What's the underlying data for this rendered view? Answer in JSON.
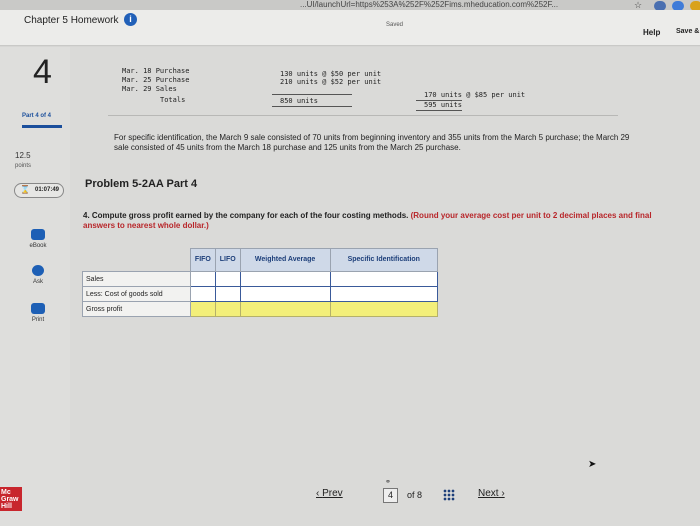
{
  "browser": {
    "url": "...UI/launchUrl=https%253A%252F%252Fims.mheducation.com%252F..."
  },
  "header": {
    "title": "Chapter 5 Homework",
    "info_glyph": "i",
    "saved": "Saved",
    "help": "Help",
    "save_exit": "Save &"
  },
  "sidebar": {
    "question_number": "4",
    "part": "Part 4 of 4",
    "points_value": "12.5",
    "points_label": "points",
    "timer": "01:07:49",
    "tools": [
      {
        "label": "eBook",
        "icon": "book-icon"
      },
      {
        "label": "Ask",
        "icon": "chat-icon"
      },
      {
        "label": "Print",
        "icon": "print-icon"
      }
    ],
    "logo": "Mc Graw Hill"
  },
  "transactions": {
    "rows": [
      {
        "label": "Mar. 18 Purchase",
        "units": "130 units @ $50 per unit"
      },
      {
        "label": "Mar. 25 Purchase",
        "units": "210 units @ $52 per unit"
      },
      {
        "label": "Mar. 29 Sales",
        "units": "",
        "sales": "170 units @ $85 per unit"
      },
      {
        "label": "Totals",
        "units": "850 units",
        "sales": "595 units"
      }
    ]
  },
  "problem": {
    "specific_id_note": "For specific identification, the March 9 sale consisted of 70 units from beginning inventory and 355 units from the March 5 purchase; the March 29 sale consisted of 45 units from the March 18 purchase and 125 units from the March 25 purchase.",
    "title": "Problem 5-2AA Part 4",
    "instruction": "4. Compute gross profit earned by the company for each of the four costing methods.",
    "instruction_emphasis": "(Round your average cost per unit to 2 decimal places and final answers to nearest whole dollar.)"
  },
  "table": {
    "headers": [
      "FIFO",
      "LIFO",
      "Weighted Average",
      "Specific Identification"
    ],
    "rows": [
      "Sales",
      "Less: Cost of goods sold",
      "Gross profit"
    ]
  },
  "footer": {
    "prev": "Prev",
    "page": "4",
    "of": "of 8",
    "next": "Next"
  }
}
